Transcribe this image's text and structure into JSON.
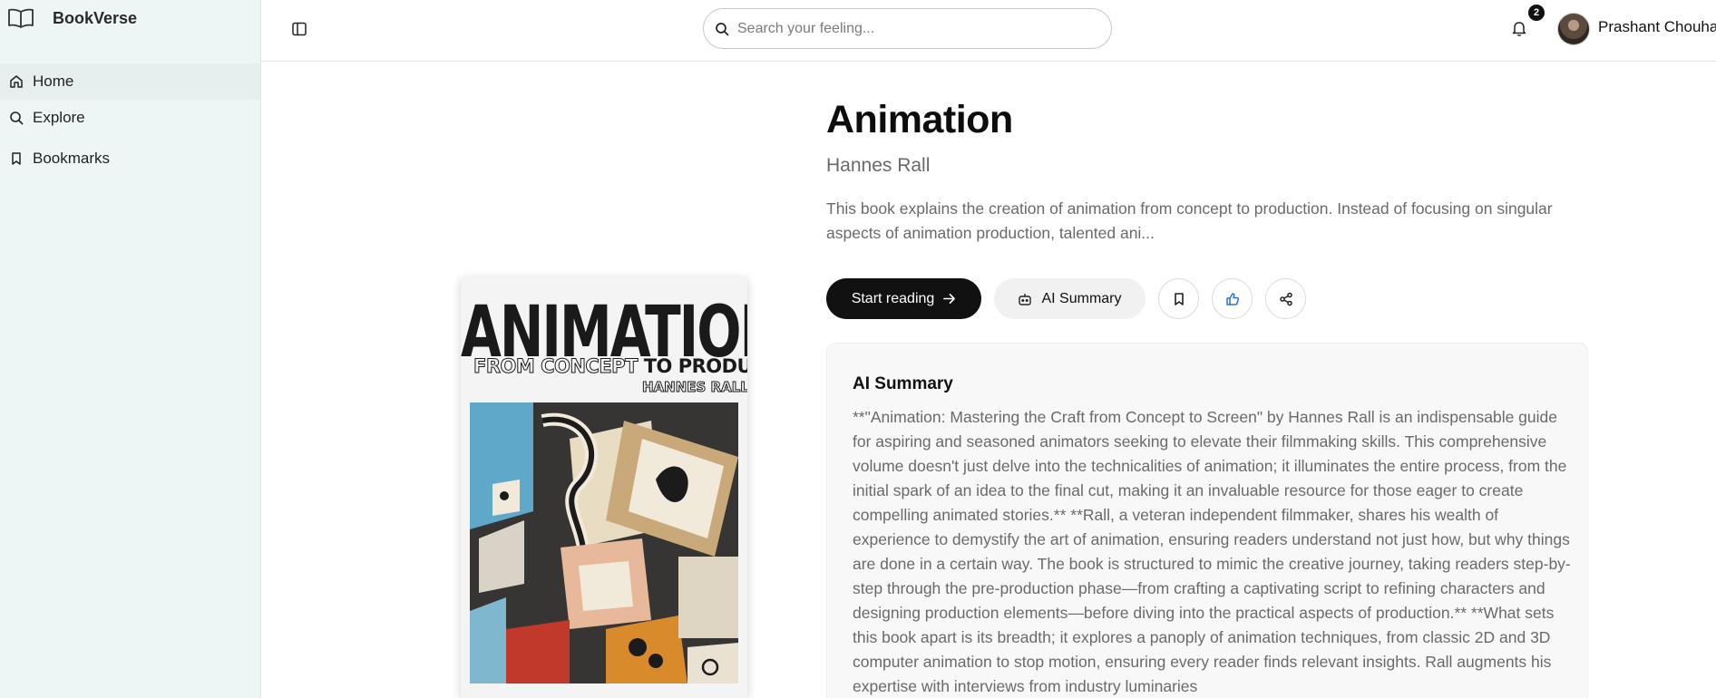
{
  "app": {
    "name": "BookVerse",
    "logo_icon": "book-open-icon"
  },
  "sidebar": {
    "items": [
      {
        "label": "Home",
        "icon": "home-icon",
        "active": true
      },
      {
        "label": "Explore",
        "icon": "search-icon",
        "active": false
      },
      {
        "label": "Bookmarks",
        "icon": "bookmark-icon",
        "active": false
      }
    ]
  },
  "header": {
    "search_placeholder": "Search your feeling...",
    "notification_count": "2",
    "user_name": "Prashant Chouhan"
  },
  "book": {
    "title": "Animation",
    "author": "Hannes Rall",
    "description": "This book explains the creation of animation from concept to production. Instead of focusing on singular aspects of animation production, talented ani...",
    "cover": {
      "title": "ANIMATION",
      "subtitle_outline": "FROM CONCEPT",
      "subtitle_solid": "TO PRODUCTION",
      "author": "HANNES RALL"
    }
  },
  "actions": {
    "start_reading": "Start reading",
    "ai_summary": "AI Summary"
  },
  "summary": {
    "title": "AI Summary",
    "text": "**\"Animation: Mastering the Craft from Concept to Screen\" by Hannes Rall is an indispensable guide for aspiring and seasoned animators seeking to elevate their filmmaking skills. This comprehensive volume doesn't just delve into the technicalities of animation; it illuminates the entire process, from the initial spark of an idea to the final cut, making it an invaluable resource for those eager to create compelling animated stories.** **Rall, a veteran independent filmmaker, shares his wealth of experience to demystify the art of animation, ensuring readers understand not just how, but why things are done in a certain way. The book is structured to mimic the creative journey, taking readers step-by-step through the pre-production phase—from crafting a captivating script to refining characters and designing production elements—before diving into the practical aspects of production.** **What sets this book apart is its breadth; it explores a panoply of animation techniques, from classic 2D and 3D computer animation to stop motion, ensuring every reader finds relevant insights. Rall augments his expertise with interviews from industry luminaries"
  },
  "colors": {
    "primary": "#111111",
    "sidebar_bg": "#eef5f5",
    "like_accent": "#2f6fd6",
    "muted_text": "#6a6a6a"
  }
}
